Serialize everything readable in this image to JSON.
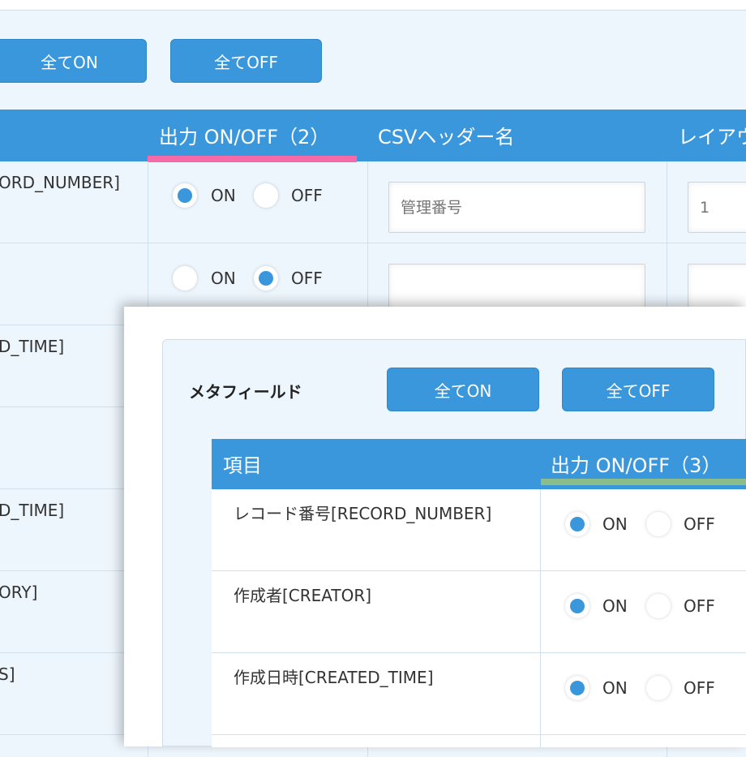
{
  "back_panel": {
    "buttons": {
      "all_on": "全てON",
      "all_off": "全てOFF"
    },
    "columns": {
      "output": "出力 ON/OFF（2）",
      "csv_header": "CSVヘッダー名",
      "layout": "レイアウ"
    },
    "rows": [
      {
        "name": "ORD_NUMBER]",
        "output": "on",
        "csv_placeholder": "管理番号",
        "layout_placeholder": "1"
      },
      {
        "name": "",
        "output": "off",
        "csv_placeholder": "",
        "layout_placeholder": ""
      },
      {
        "name": "D_TIME]"
      },
      {
        "name": ""
      },
      {
        "name": "D_TIME]"
      },
      {
        "name": "ORY]"
      },
      {
        "name": "S]"
      }
    ]
  },
  "front_panel": {
    "title": "メタフィールド",
    "buttons": {
      "all_on": "全てON",
      "all_off": "全てOFF"
    },
    "columns": {
      "item": "項目",
      "output": "出力 ON/OFF（3）"
    },
    "rows": [
      {
        "name": "レコード番号[RECORD_NUMBER]",
        "output": "on"
      },
      {
        "name": "作成者[CREATOR]",
        "output": "on"
      },
      {
        "name": "作成日時[CREATED_TIME]",
        "output": "on"
      }
    ]
  },
  "radio_labels": {
    "on": "ON",
    "off": "OFF"
  },
  "colors": {
    "accent": "#3a97dc",
    "highlight_pink": "#f56aa9",
    "highlight_green": "#8bbd8a",
    "background": "#eef6fd"
  }
}
